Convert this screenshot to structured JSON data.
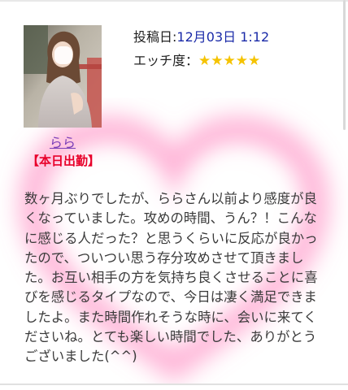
{
  "post": {
    "date_label": "投稿日:",
    "date_value": "12月03日 1:12",
    "rating_label": "エッチ度：",
    "rating_stars": "★★★★★",
    "rating_value": 5
  },
  "girl": {
    "name": "らら",
    "status": "【本日出勤】"
  },
  "review": {
    "text": "数ヶ月ぶりでしたが、ららさん以前より感度が良くなっていました。攻めの時間、うん？！こんなに感じる人だった？と思うくらいに反応が良かったので、ついつい思う存分攻めさせて頂きました。お互い相手の方を気持ち良くさせることに喜びを感じるタイプなので、今日は凄く満足できましたよ。また時間作れそうな時に、会いに来てくださいね。とても楽しい時間でした、ありがとうございました(^^)"
  },
  "colors": {
    "name_link": "#7a3fb8",
    "status_red": "#e8002a",
    "date_blue": "#1a2aa8",
    "star_gold": "#f5c300",
    "heart_pink": "#ff6fb0"
  }
}
